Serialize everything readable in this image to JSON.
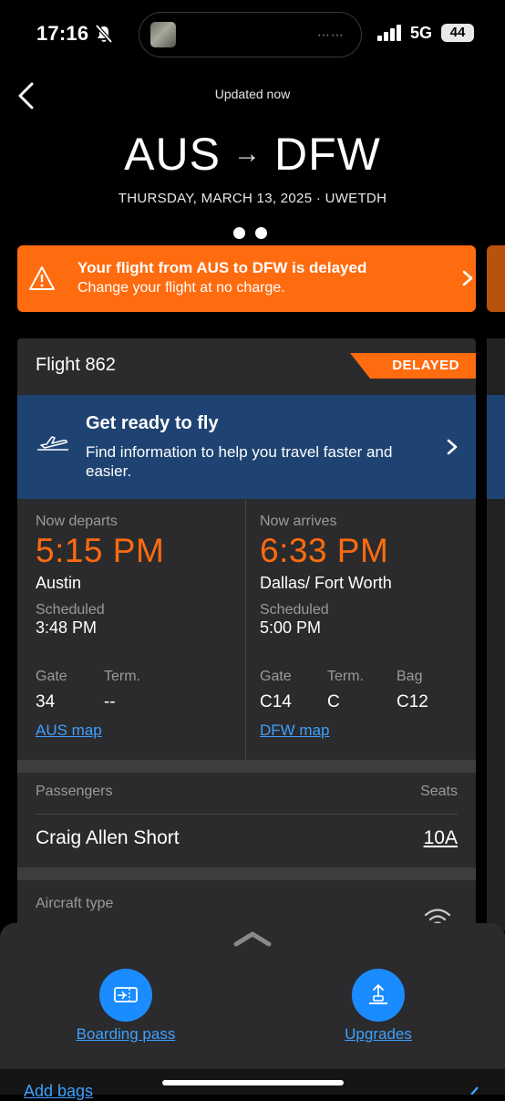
{
  "status_bar": {
    "time": "17:16",
    "network": "5G",
    "battery": "44"
  },
  "header": {
    "updated": "Updated now",
    "origin": "AUS",
    "destination": "DFW",
    "date_line": "THURSDAY, MARCH 13, 2025 · UWETDH"
  },
  "alert": {
    "title": "Your flight from AUS to DFW is delayed",
    "subtitle": "Change your flight at no charge."
  },
  "flight": {
    "number": "Flight 862",
    "status": "DELAYED",
    "ready_title": "Get ready to fly",
    "ready_subtitle": "Find information to help you travel faster and easier."
  },
  "departure": {
    "label": "Now departs",
    "time": "5:15 PM",
    "city": "Austin",
    "scheduled_label": "Scheduled",
    "scheduled": "3:48 PM",
    "gate_label": "Gate",
    "gate": "34",
    "term_label": "Term.",
    "term": "--",
    "map_link": "AUS map"
  },
  "arrival": {
    "label": "Now arrives",
    "time": "6:33 PM",
    "city": "Dallas/ Fort Worth",
    "scheduled_label": "Scheduled",
    "scheduled": "5:00 PM",
    "gate_label": "Gate",
    "gate": "C14",
    "term_label": "Term.",
    "term": "C",
    "bag_label": "Bag",
    "bag": "C12",
    "map_link": "DFW map"
  },
  "passengers": {
    "label": "Passengers",
    "seats_label": "Seats",
    "list": [
      {
        "name": "Craig Allen Short",
        "seat": "10A"
      }
    ]
  },
  "aircraft": {
    "label": "Aircraft type"
  },
  "bottom_sheet": {
    "boarding_pass": "Boarding pass",
    "upgrades": "Upgrades"
  },
  "below": {
    "add_bags": "Add bags"
  },
  "colors": {
    "accent_orange": "#ff6b0f",
    "link_blue": "#3ea0ff",
    "banner_blue": "#1e4373"
  }
}
